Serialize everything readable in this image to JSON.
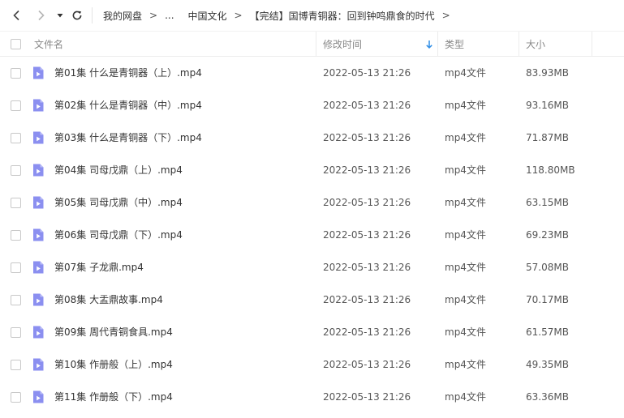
{
  "breadcrumb": {
    "items": [
      "我的网盘",
      "...",
      "中国文化",
      "【完结】国博青铜器：回到钟鸣鼎食的时代"
    ],
    "separator": ">"
  },
  "columns": {
    "name": "文件名",
    "modified": "修改时间",
    "type": "类型",
    "size": "大小"
  },
  "sort": {
    "column": "modified",
    "direction": "desc"
  },
  "colors": {
    "file_icon": "#8b8ff0",
    "sort_arrow": "#2e8de6",
    "text": "#333333",
    "muted": "#888888"
  },
  "icons": {
    "back": "chevron-left-icon",
    "forward": "chevron-right-icon",
    "history": "caret-down-icon",
    "refresh": "refresh-icon",
    "file": "video-file-icon",
    "sort": "arrow-down-icon"
  },
  "files": [
    {
      "name": "第01集 什么是青铜器（上）.mp4",
      "modified": "2022-05-13 21:26",
      "type": "mp4文件",
      "size": "83.93MB"
    },
    {
      "name": "第02集 什么是青铜器（中）.mp4",
      "modified": "2022-05-13 21:26",
      "type": "mp4文件",
      "size": "93.16MB"
    },
    {
      "name": "第03集 什么是青铜器（下）.mp4",
      "modified": "2022-05-13 21:26",
      "type": "mp4文件",
      "size": "71.87MB"
    },
    {
      "name": "第04集 司母戊鼎（上）.mp4",
      "modified": "2022-05-13 21:26",
      "type": "mp4文件",
      "size": "118.80MB"
    },
    {
      "name": "第05集 司母戊鼎（中）.mp4",
      "modified": "2022-05-13 21:26",
      "type": "mp4文件",
      "size": "63.15MB"
    },
    {
      "name": "第06集 司母戊鼎（下）.mp4",
      "modified": "2022-05-13 21:26",
      "type": "mp4文件",
      "size": "69.23MB"
    },
    {
      "name": "第07集 子龙鼎.mp4",
      "modified": "2022-05-13 21:26",
      "type": "mp4文件",
      "size": "57.08MB"
    },
    {
      "name": "第08集 大盂鼎故事.mp4",
      "modified": "2022-05-13 21:26",
      "type": "mp4文件",
      "size": "70.17MB"
    },
    {
      "name": "第09集 周代青铜食具.mp4",
      "modified": "2022-05-13 21:26",
      "type": "mp4文件",
      "size": "61.57MB"
    },
    {
      "name": "第10集 作册般（上）.mp4",
      "modified": "2022-05-13 21:26",
      "type": "mp4文件",
      "size": "49.35MB"
    },
    {
      "name": "第11集 作册般（下）.mp4",
      "modified": "2022-05-13 21:26",
      "type": "mp4文件",
      "size": "63.36MB"
    }
  ]
}
